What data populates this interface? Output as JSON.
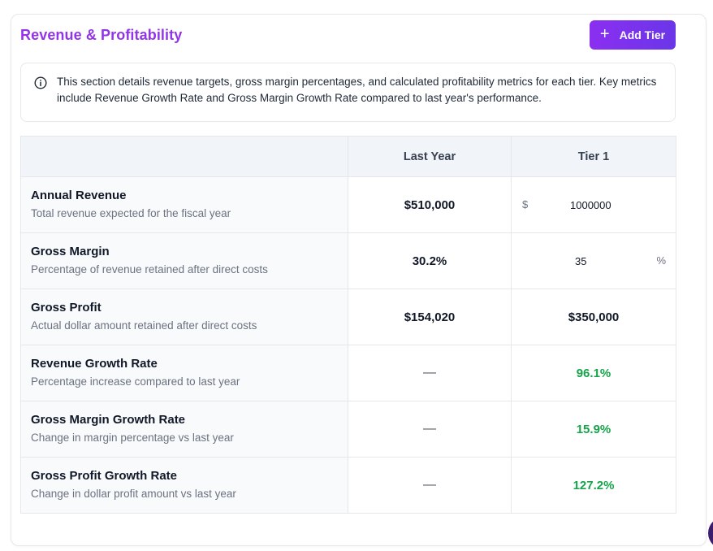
{
  "header": {
    "title": "Revenue & Profitability",
    "add_button_label": "Add Tier",
    "add_button_icon": "plus-icon",
    "accent_color": "#9333ea"
  },
  "info": {
    "icon": "info-icon",
    "text": "This section details revenue targets, gross margin percentages, and calculated profitability metrics for each tier. Key metrics include Revenue Growth Rate and Gross Margin Growth Rate compared to last year's performance."
  },
  "table": {
    "columns": [
      "",
      "Last Year",
      "Tier 1"
    ],
    "rows": [
      {
        "name": "Annual Revenue",
        "desc": "Total revenue expected for the fiscal year",
        "last_year": "$510,000",
        "tier1_prefix": "$",
        "tier1_value": "1000000"
      },
      {
        "name": "Gross Margin",
        "desc": "Percentage of revenue retained after direct costs",
        "last_year": "30.2%",
        "tier1_value": "35",
        "tier1_suffix": "%"
      },
      {
        "name": "Gross Profit",
        "desc": "Actual dollar amount retained after direct costs",
        "last_year": "$154,020",
        "tier1_value": "$350,000"
      },
      {
        "name": "Revenue Growth Rate",
        "desc": "Percentage increase compared to last year",
        "last_year": "—",
        "tier1_value": "96.1%"
      },
      {
        "name": "Gross Margin Growth Rate",
        "desc": "Change in margin percentage vs last year",
        "last_year": "—",
        "tier1_value": "15.9%"
      },
      {
        "name": "Gross Profit Growth Rate",
        "desc": "Change in dollar profit amount vs last year",
        "last_year": "—",
        "tier1_value": "127.2%"
      }
    ],
    "positive_color": "#16a34a"
  }
}
